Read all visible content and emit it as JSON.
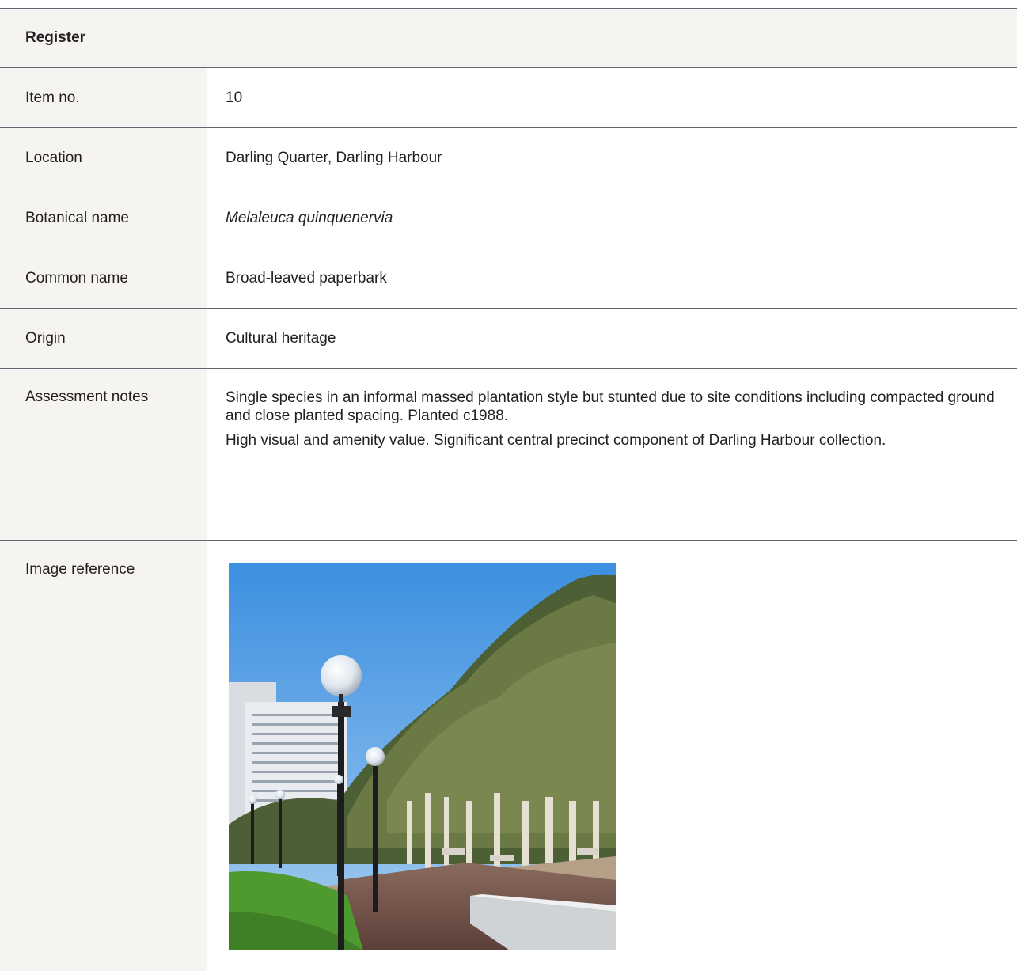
{
  "register": {
    "title": "Register"
  },
  "rows": {
    "item_no": {
      "label": "Item no.",
      "value": "10"
    },
    "location": {
      "label": "Location",
      "value": "Darling Quarter, Darling Harbour"
    },
    "botanical_name": {
      "label": "Botanical name",
      "value": "Melaleuca quinquenervia"
    },
    "common_name": {
      "label": "Common name",
      "value": "Broad-leaved paperbark"
    },
    "origin": {
      "label": "Origin",
      "value": "Cultural heritage"
    },
    "assessment_notes": {
      "label": "Assessment notes",
      "paragraphs": [
        "Single species in an informal massed plantation style but stunted due to site conditions including compacted ground and close planted spacing. Planted c1988.",
        "High visual and amenity value. Significant central precinct component of Darling Harbour collection."
      ]
    },
    "image_reference": {
      "label": "Image reference"
    }
  },
  "colors": {
    "label_background": "#f5f4f1",
    "rule_line": "#5f6770",
    "text": "#231f20"
  }
}
